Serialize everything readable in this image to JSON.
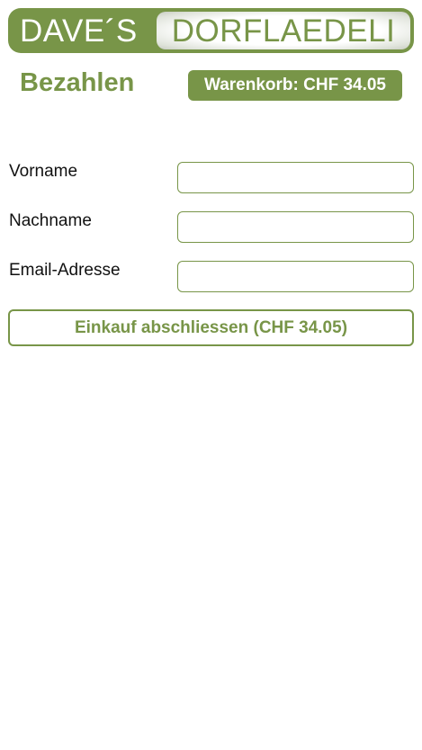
{
  "logo": {
    "left_text": "DAVE´S",
    "right_text": "DORFLAEDELI"
  },
  "header": {
    "title": "Bezahlen",
    "cart_label": "Warenkorb: CHF 34.05"
  },
  "form": {
    "fields": [
      {
        "label": "Vorname",
        "value": "",
        "placeholder": ""
      },
      {
        "label": "Nachname",
        "value": "",
        "placeholder": ""
      },
      {
        "label": "Email-Adresse",
        "value": "",
        "placeholder": ""
      }
    ],
    "submit_label": "Einkauf abschliessen (CHF 34.05)"
  },
  "colors": {
    "brand": "#789548",
    "background": "#ffffff"
  }
}
